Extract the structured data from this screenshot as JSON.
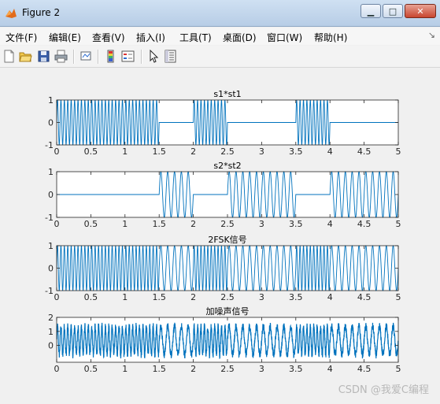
{
  "window": {
    "title": "Figure 2"
  },
  "window_controls": {
    "minimize": "▁",
    "maximize": "□",
    "close": "✕"
  },
  "menu": [
    "文件(F)",
    "编辑(E)",
    "查看(V)",
    "插入(I)",
    "工具(T)",
    "桌面(D)",
    "窗口(W)",
    "帮助(H)"
  ],
  "toolbar_icons": [
    "new-figure-icon",
    "open-file-icon",
    "save-icon",
    "print-icon",
    "link-plot-icon",
    "colorbar-icon",
    "legend-icon",
    "pointer-icon",
    "property-inspector-icon"
  ],
  "watermark": "CSDN @我爱C编程",
  "colors": {
    "line": "#0072bd",
    "axes_bg": "#ffffff",
    "figure_bg": "#f0f0f0"
  },
  "chart_data": [
    {
      "type": "line",
      "title": "s1*st1",
      "xlabel": "",
      "ylabel": "",
      "xlim": [
        0,
        5
      ],
      "ylim": [
        -1,
        1
      ],
      "xticks": [
        "0",
        "0.5",
        "1",
        "1.5",
        "2",
        "2.5",
        "3",
        "3.5",
        "4",
        "4.5",
        "5"
      ],
      "yticks": [
        "-1",
        "0",
        "1"
      ],
      "bits": [
        1,
        1,
        1,
        0,
        1,
        0,
        0,
        1,
        0,
        0
      ],
      "bit_duration": 0.5,
      "frequency": 20,
      "series": [
        {
          "signal": "s1*st1"
        }
      ]
    },
    {
      "type": "line",
      "title": "s2*st2",
      "xlabel": "",
      "ylabel": "",
      "xlim": [
        0,
        5
      ],
      "ylim": [
        -1,
        1
      ],
      "xticks": [
        "0",
        "0.5",
        "1",
        "1.5",
        "2",
        "2.5",
        "3",
        "3.5",
        "4",
        "4.5",
        "5"
      ],
      "yticks": [
        "-1",
        "0",
        "1"
      ],
      "bits": [
        0,
        0,
        0,
        1,
        0,
        1,
        1,
        0,
        1,
        1
      ],
      "bit_duration": 0.5,
      "frequency": 10,
      "series": [
        {
          "signal": "s2*st2"
        }
      ]
    },
    {
      "type": "line",
      "title": "2FSK信号",
      "xlabel": "",
      "ylabel": "",
      "xlim": [
        0,
        5
      ],
      "ylim": [
        -1,
        1
      ],
      "xticks": [
        "0",
        "0.5",
        "1",
        "1.5",
        "2",
        "2.5",
        "3",
        "3.5",
        "4",
        "4.5",
        "5"
      ],
      "yticks": [
        "-1",
        "0",
        "1"
      ],
      "bits": [
        1,
        1,
        1,
        0,
        1,
        0,
        0,
        1,
        0,
        0
      ],
      "bit_duration": 0.5,
      "frequency_mark": 20,
      "frequency_space": 10,
      "series": [
        {
          "signal": "2FSK"
        }
      ]
    },
    {
      "type": "line",
      "title": "加噪声信号",
      "xlabel": "",
      "ylabel": "",
      "xlim": [
        0,
        5
      ],
      "ylim": [
        -1.2,
        2
      ],
      "xticks": [
        "0",
        "0.5",
        "1",
        "1.5",
        "2",
        "2.5",
        "3",
        "3.5",
        "4",
        "4.5",
        "5"
      ],
      "yticks": [
        "0",
        "1",
        "2"
      ],
      "bits": [
        1,
        1,
        1,
        0,
        1,
        0,
        0,
        1,
        0,
        0
      ],
      "bit_duration": 0.5,
      "frequency_mark": 20,
      "frequency_space": 10,
      "noise_amplitude": 0.28,
      "offset": 0.35,
      "series": [
        {
          "signal": "2FSK + noise"
        }
      ]
    }
  ]
}
